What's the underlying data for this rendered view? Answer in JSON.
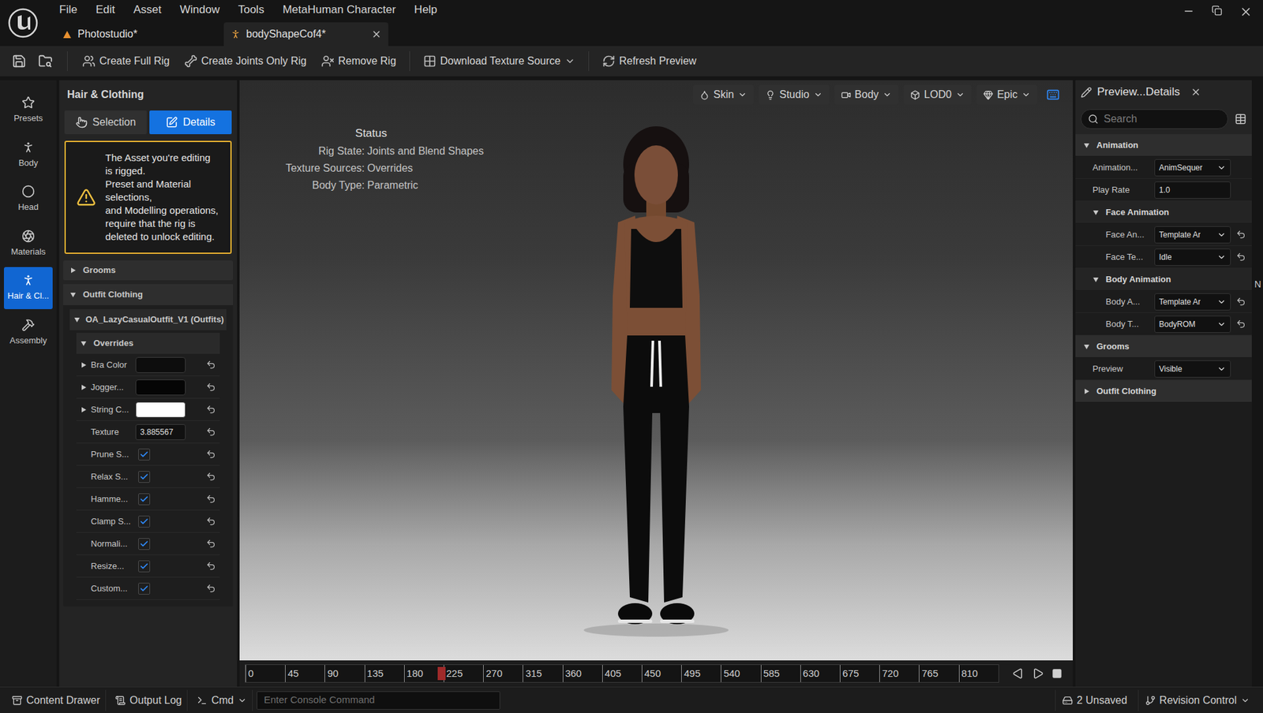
{
  "window": {
    "menu": [
      "File",
      "Edit",
      "Asset",
      "Window",
      "Tools",
      "MetaHuman Character",
      "Help"
    ]
  },
  "tabs": [
    {
      "label": "Photostudio*",
      "selected": false
    },
    {
      "label": "bodyShapeCof4*",
      "selected": true
    }
  ],
  "toolbar": [
    {
      "label": "Create Full Rig",
      "dropdown": false
    },
    {
      "label": "Create Joints Only Rig",
      "dropdown": false
    },
    {
      "label": "Remove Rig",
      "dropdown": false
    },
    {
      "label": "Download Texture Source",
      "dropdown": true
    },
    {
      "label": "Refresh Preview",
      "dropdown": false
    }
  ],
  "rail": [
    {
      "label": "Presets",
      "selected": false
    },
    {
      "label": "Body",
      "selected": false
    },
    {
      "label": "Head",
      "selected": false
    },
    {
      "label": "Materials",
      "selected": false
    },
    {
      "label": "Hair & Cl...",
      "selected": true
    },
    {
      "label": "Assembly",
      "selected": false
    }
  ],
  "left_panel": {
    "title": "Hair & Clothing",
    "modes": [
      {
        "label": "Selection",
        "selected": false
      },
      {
        "label": "Details",
        "selected": true
      }
    ],
    "warning": [
      "The Asset you're editing is rigged.",
      "Preset and Material selections,",
      "and Modelling operations, require that the rig is deleted to unlock editing."
    ],
    "grooms": {
      "title": "Grooms",
      "expanded": false
    },
    "outfit_clothing": {
      "title": "Outfit Clothing",
      "expanded": true
    },
    "outfit": {
      "title": "OA_LazyCasualOutfit_V1 (Outfits)",
      "expanded": true
    },
    "overrides": {
      "title": "Overrides",
      "expanded": true,
      "rows": [
        {
          "label": "Bra Color",
          "kind": "color",
          "value": "#0d0d0d",
          "expandable": true
        },
        {
          "label": "Jogger...",
          "kind": "color",
          "value": "#050505",
          "expandable": true
        },
        {
          "label": "String C...",
          "kind": "color",
          "value": "#ffffff",
          "expandable": true
        },
        {
          "label": "Texture",
          "kind": "number",
          "value": "3.885567",
          "expandable": false
        },
        {
          "label": "Prune S...",
          "kind": "checkbox",
          "checked": true,
          "expandable": false
        },
        {
          "label": "Relax S...",
          "kind": "checkbox",
          "checked": true,
          "expandable": false
        },
        {
          "label": "Hamme...",
          "kind": "checkbox",
          "checked": true,
          "expandable": false
        },
        {
          "label": "Clamp S...",
          "kind": "checkbox",
          "checked": true,
          "expandable": false
        },
        {
          "label": "Normali...",
          "kind": "checkbox",
          "checked": true,
          "expandable": false
        },
        {
          "label": "Resize...",
          "kind": "checkbox",
          "checked": true,
          "expandable": false
        },
        {
          "label": "Custom...",
          "kind": "checkbox",
          "checked": true,
          "expandable": false
        }
      ]
    }
  },
  "viewport": {
    "buttons": [
      "Skin",
      "Studio",
      "Body",
      "LOD0",
      "Epic"
    ],
    "status": {
      "title": "Status",
      "lines": [
        {
          "label": "Rig State:",
          "value": "Joints and Blend Shapes"
        },
        {
          "label": "Texture Sources:",
          "value": "Overrides"
        },
        {
          "label": "Body Type:",
          "value": "Parametric"
        }
      ]
    },
    "timeline": {
      "ticks": [
        "0",
        "45",
        "90",
        "135",
        "180",
        "225",
        "270",
        "315",
        "360",
        "405",
        "450",
        "495",
        "540",
        "585",
        "630",
        "675",
        "720",
        "765",
        "810"
      ],
      "level": 0.255
    }
  },
  "right_panel": {
    "title": "Preview...Details",
    "search_placeholder": "Search",
    "sections": [
      {
        "title": "Animation",
        "expanded": true,
        "nested": false,
        "rows": [
          {
            "label": "Animation...",
            "kind": "dropdown",
            "value": "AnimSequer",
            "resettable": false
          },
          {
            "label": "Play Rate",
            "kind": "input",
            "value": "1.0",
            "resettable": false
          }
        ]
      },
      {
        "title": "Face Animation",
        "expanded": true,
        "nested": true,
        "rows": [
          {
            "label": "Face An...",
            "kind": "dropdown",
            "value": "Template Ar",
            "resettable": true
          },
          {
            "label": "Face Te...",
            "kind": "dropdown",
            "value": "Idle",
            "resettable": true
          }
        ]
      },
      {
        "title": "Body Animation",
        "expanded": true,
        "nested": true,
        "rows": [
          {
            "label": "Body A...",
            "kind": "dropdown",
            "value": "Template Ar",
            "resettable": true
          },
          {
            "label": "Body T...",
            "kind": "dropdown",
            "value": "BodyROM",
            "resettable": true
          }
        ]
      },
      {
        "title": "Grooms",
        "expanded": true,
        "nested": false,
        "rows": [
          {
            "label": "Preview",
            "kind": "dropdown",
            "value": "Visible",
            "resettable": false
          }
        ]
      },
      {
        "title": "Outfit Clothing",
        "expanded": false,
        "nested": false,
        "rows": []
      }
    ],
    "edge_text": "N"
  },
  "status_bar": {
    "left": [
      {
        "label": "Content Drawer",
        "dropdown": false
      },
      {
        "label": "Output Log",
        "dropdown": false
      },
      {
        "label": "Cmd",
        "dropdown": true
      }
    ],
    "console_placeholder": "Enter Console Command",
    "unsaved": "2 Unsaved",
    "revision": "Revision Control"
  }
}
